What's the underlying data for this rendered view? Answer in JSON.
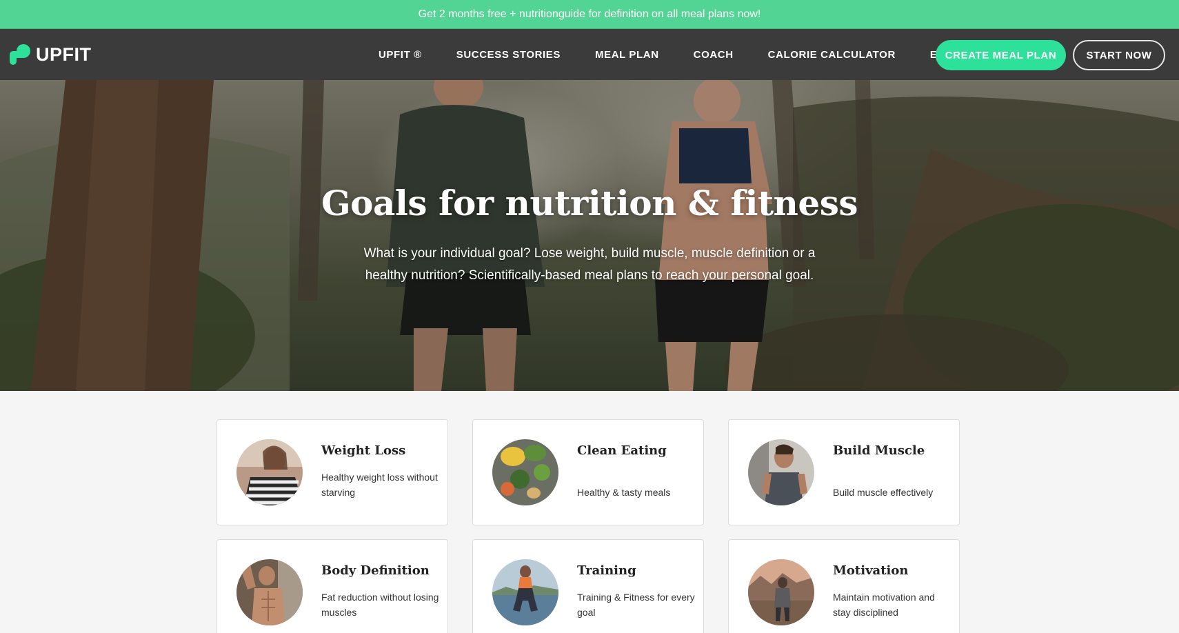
{
  "promo": {
    "text": "Get 2 months free + nutritionguide for definition on all meal plans now!"
  },
  "navbar": {
    "brand": "UPFIT",
    "items": [
      {
        "label": "UPFIT ®"
      },
      {
        "label": "SUCCESS STORIES"
      },
      {
        "label": "MEAL PLAN"
      },
      {
        "label": "COACH"
      },
      {
        "label": "CALORIE CALCULATOR"
      },
      {
        "label": "EN"
      }
    ],
    "create_label": "CREATE MEAL PLAN",
    "start_label": "START NOW"
  },
  "hero": {
    "title": "Goals for nutrition & fitness",
    "subtitle": "What is your individual goal? Lose weight, build muscle, muscle definition or a healthy nutrition? Scientifically-based meal plans to reach your personal goal."
  },
  "goals": [
    {
      "title": "Weight Loss",
      "desc": "Healthy weight loss without starving"
    },
    {
      "title": "Clean Eating",
      "desc": "Healthy & tasty meals"
    },
    {
      "title": "Build Muscle",
      "desc": "Build muscle effectively"
    },
    {
      "title": "Body Definition",
      "desc": "Fat reduction without losing muscles"
    },
    {
      "title": "Training",
      "desc": "Training & Fitness for every goal"
    },
    {
      "title": "Motivation",
      "desc": "Maintain motivation and stay disciplined"
    }
  ],
  "colors": {
    "accent": "#2ee19b",
    "promo": "#52d494",
    "nav_bg": "#3b3b3b"
  }
}
